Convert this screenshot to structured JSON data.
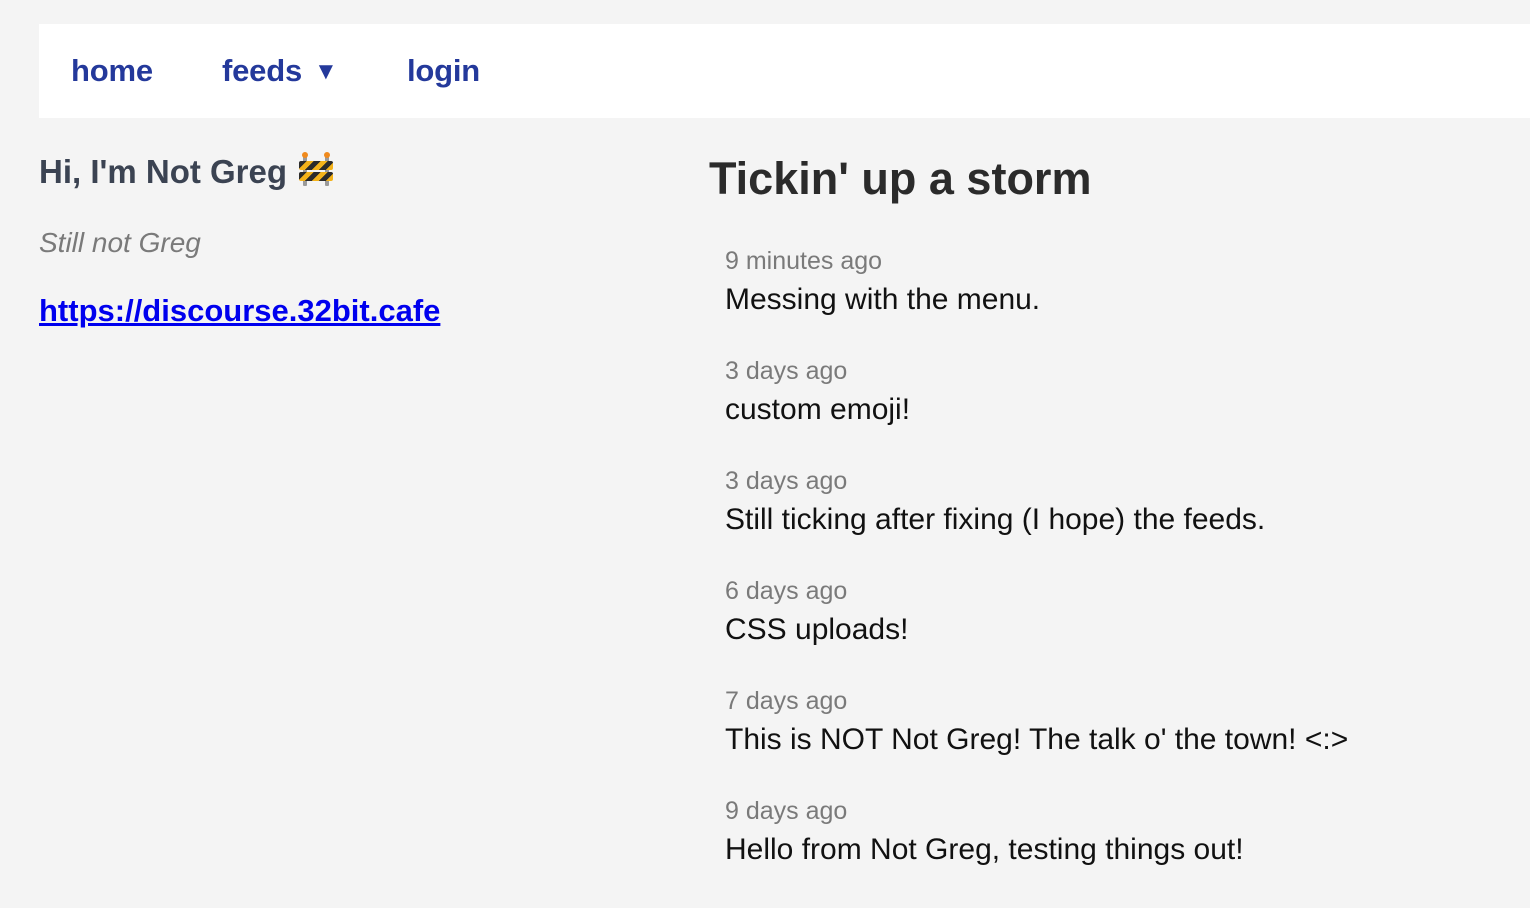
{
  "nav": {
    "home": "home",
    "feeds": "feeds",
    "feeds_caret": "▼",
    "login": "login"
  },
  "profile": {
    "name": "Hi, I'm Not Greg",
    "name_emoji": "construction-barrier-emoji",
    "tagline": "Still not Greg",
    "link": "https://discourse.32bit.cafe"
  },
  "feed": {
    "title": "Tickin' up a storm",
    "items": [
      {
        "time": "9 minutes ago",
        "text": "Messing with the menu."
      },
      {
        "time": "3 days ago",
        "text": "custom emoji!"
      },
      {
        "time": "3 days ago",
        "text": "Still ticking after fixing (I hope) the feeds."
      },
      {
        "time": "6 days ago",
        "text": "CSS uploads!"
      },
      {
        "time": "7 days ago",
        "text": "This is NOT Not Greg! The talk o' the town! <:>"
      },
      {
        "time": "9 days ago",
        "text": "Hello from Not Greg, testing things out!"
      }
    ]
  },
  "colors": {
    "background": "#f4f4f4",
    "nav_link": "#24399b",
    "link": "#0000ee",
    "muted": "#7a7a7a"
  }
}
